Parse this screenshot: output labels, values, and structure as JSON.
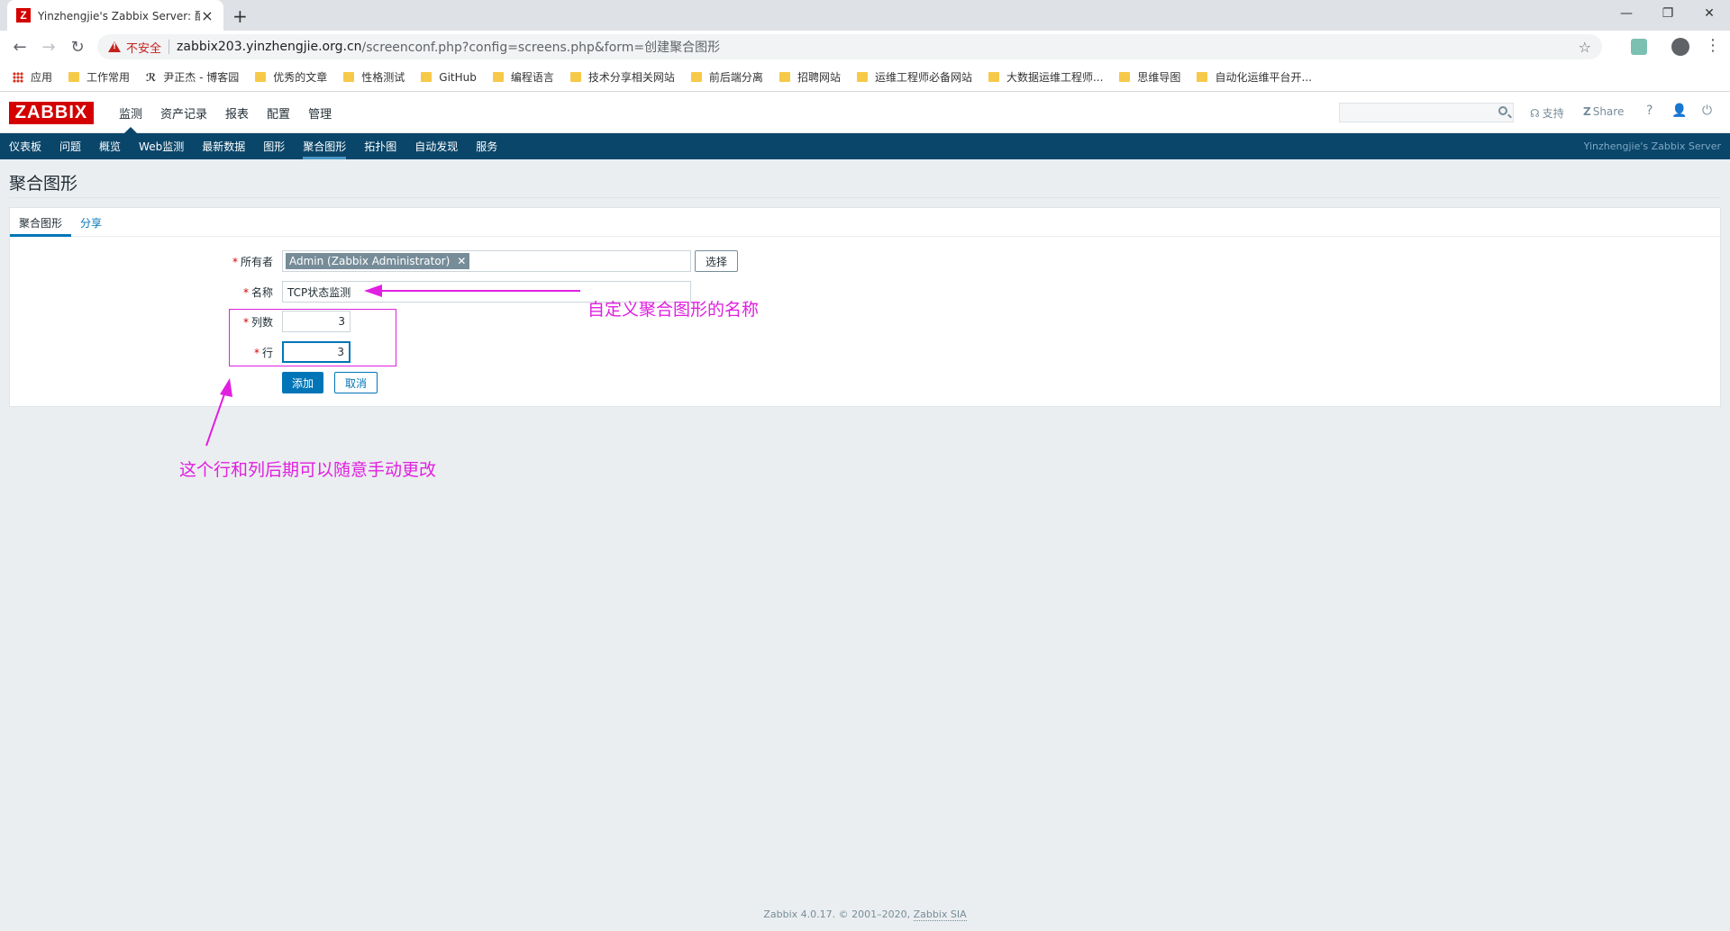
{
  "browser": {
    "tab_title": "Yinzhengjie's Zabbix Server: 配置",
    "tab_favicon": "Z",
    "security_label": "不安全",
    "url_host": "zabbix203.yinzhengjie.org.cn",
    "url_path": "/screenconf.php?config=screens.php&form=创建聚合图形",
    "bookmarks": [
      "应用",
      "工作常用",
      "尹正杰 - 博客园",
      "优秀的文章",
      "性格测试",
      "GitHub",
      "编程语言",
      "技术分享相关网站",
      "前后端分离",
      "招聘网站",
      "运维工程师必备网站",
      "大数据运维工程师...",
      "思维导图",
      "自动化运维平台开..."
    ]
  },
  "zabbix": {
    "logo": "ZABBIX",
    "top_menu": [
      "监测",
      "资产记录",
      "报表",
      "配置",
      "管理"
    ],
    "active_top": "监测",
    "support": "支持",
    "share": "Share",
    "help": "?",
    "sub_menu": [
      "仪表板",
      "问题",
      "概览",
      "Web监测",
      "最新数据",
      "图形",
      "聚合图形",
      "拓扑图",
      "自动发现",
      "服务"
    ],
    "active_sub": "聚合图形",
    "server_name": "Yinzhengjie's Zabbix Server"
  },
  "page": {
    "title": "聚合图形",
    "tabs": [
      "聚合图形",
      "分享"
    ],
    "form": {
      "owner_label": "所有者",
      "owner_value": "Admin (Zabbix Administrator)",
      "select_button": "选择",
      "name_label": "名称",
      "name_value": "TCP状态监测",
      "columns_label": "列数",
      "columns_value": "3",
      "rows_label": "行",
      "rows_value": "3",
      "add_button": "添加",
      "cancel_button": "取消"
    }
  },
  "annotations": {
    "name_note": "自定义聚合图形的名称",
    "rows_cols_note": "这个行和列后期可以随意手动更改",
    "color": "#e020e0"
  },
  "footer": {
    "text": "Zabbix 4.0.17. © 2001–2020, ",
    "link": "Zabbix SIA"
  }
}
